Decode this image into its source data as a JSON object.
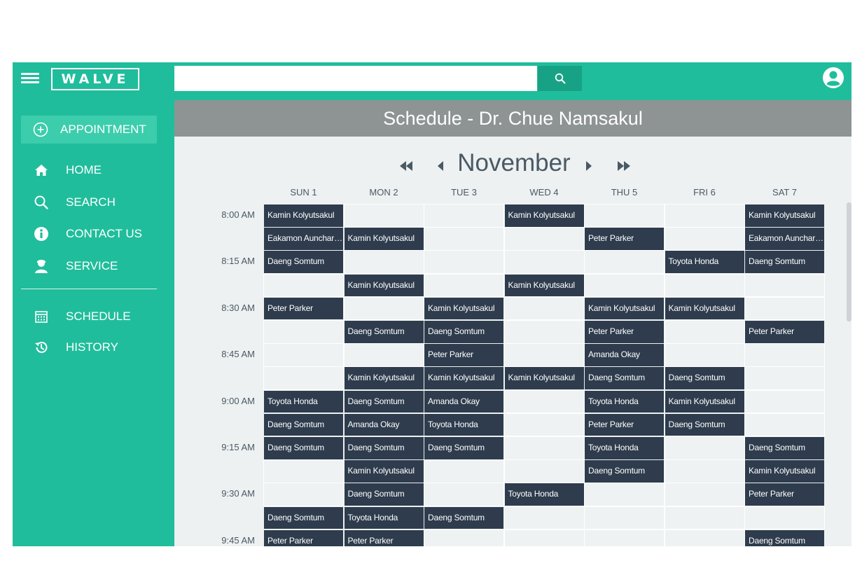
{
  "app": {
    "logo_text": "WALVE",
    "search": {
      "value": "",
      "placeholder": ""
    },
    "accent": "#20bd9c",
    "dark": "#2e3c4d"
  },
  "sidebar": {
    "appointment_label": "APPOINTMENT",
    "items": [
      {
        "label": "HOME",
        "icon": "home-icon"
      },
      {
        "label": "SEARCH",
        "icon": "search-icon"
      },
      {
        "label": "CONTACT US",
        "icon": "info-icon"
      },
      {
        "label": "SERVICE",
        "icon": "service-person-icon"
      },
      {
        "label": "SCHEDULE",
        "icon": "calendar-icon"
      },
      {
        "label": "HISTORY",
        "icon": "history-icon"
      }
    ]
  },
  "schedule": {
    "title": "Schedule - Dr. Chue Namsakul",
    "month": "November",
    "days": [
      "SUN 1",
      "MON 2",
      "TUE 3",
      "WED 4",
      "THU 5",
      "FRI 6",
      "SAT 7"
    ],
    "time_labels": [
      "8:00 AM",
      "",
      "8:15 AM",
      "",
      "8:30 AM",
      "",
      "8:45 AM",
      "",
      "9:00 AM",
      "",
      "9:15 AM",
      "",
      "9:30 AM",
      "",
      "9:45 AM"
    ],
    "grid": [
      [
        "Kamin Kolyutsakul",
        "",
        "",
        "Kamin Kolyutsakul",
        "",
        "",
        "Kamin Kolyutsakul"
      ],
      [
        "Eakamon Auncharoen",
        "Kamin Kolyutsakul",
        "",
        "",
        "Peter Parker",
        "",
        "Eakamon Auncharoen"
      ],
      [
        "Daeng Somtum",
        "",
        "",
        "",
        "",
        "Toyota Honda",
        "Daeng Somtum"
      ],
      [
        "",
        "Kamin Kolyutsakul",
        "",
        "Kamin Kolyutsakul",
        "",
        "",
        ""
      ],
      [
        "Peter Parker",
        "",
        "Kamin Kolyutsakul",
        "",
        "Kamin Kolyutsakul",
        "Kamin Kolyutsakul",
        ""
      ],
      [
        "",
        "Daeng Somtum",
        "Daeng Somtum",
        "",
        "Peter Parker",
        "",
        "Peter Parker"
      ],
      [
        "",
        "",
        "Peter Parker",
        "",
        "Amanda Okay",
        "",
        ""
      ],
      [
        "",
        "Kamin Kolyutsakul",
        "Kamin Kolyutsakul",
        "Kamin Kolyutsakul",
        "Daeng Somtum",
        "Daeng Somtum",
        ""
      ],
      [
        "Toyota Honda",
        "Daeng Somtum",
        "Amanda Okay",
        "",
        "Toyota Honda",
        "Kamin Kolyutsakul",
        ""
      ],
      [
        "Daeng Somtum",
        "Amanda Okay",
        "Toyota Honda",
        "",
        "Peter Parker",
        "Daeng Somtum",
        ""
      ],
      [
        "Daeng Somtum",
        "Daeng Somtum",
        "Daeng Somtum",
        "",
        "Toyota Honda",
        "",
        "Daeng Somtum"
      ],
      [
        "",
        "Kamin Kolyutsakul",
        "",
        "",
        "Daeng Somtum",
        "",
        "Kamin Kolyutsakul"
      ],
      [
        "",
        "Daeng Somtum",
        "",
        "Toyota Honda",
        "",
        "",
        "Peter Parker"
      ],
      [
        "Daeng Somtum",
        "Toyota Honda",
        "Daeng Somtum",
        "",
        "",
        "",
        ""
      ],
      [
        "Peter Parker",
        "Peter Parker",
        "",
        "",
        "",
        "",
        "Daeng Somtum"
      ]
    ]
  }
}
